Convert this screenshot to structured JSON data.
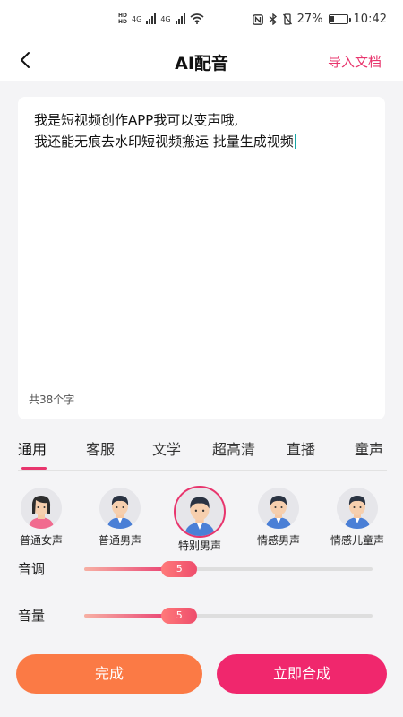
{
  "status_bar": {
    "network_1": "4G",
    "network_2": "4G",
    "battery_percent": "27%",
    "battery_level": 0.27,
    "time": "10:42",
    "icons": [
      "nfc-icon",
      "bluetooth-icon",
      "mute-icon",
      "battery-icon",
      "wifi-icon",
      "signal-icon"
    ]
  },
  "header": {
    "title": "AI配音",
    "import_label": "导入文档"
  },
  "editor": {
    "line1": "我是短视频创作APP我可以变声哦,",
    "line2": "我还能无痕去水印短视频搬运 批量生成视频",
    "char_count": "共38个字"
  },
  "tabs": [
    {
      "label": "通用",
      "active": true
    },
    {
      "label": "客服"
    },
    {
      "label": "文学"
    },
    {
      "label": "超高清"
    },
    {
      "label": "直播"
    },
    {
      "label": "童声"
    }
  ],
  "voices": [
    {
      "label": "普通女声"
    },
    {
      "label": "普通男声"
    },
    {
      "label": "特别男声",
      "selected": true
    },
    {
      "label": "情感男声"
    },
    {
      "label": "情感儿童声"
    }
  ],
  "sliders": {
    "pitch": {
      "label": "音调",
      "value": "5",
      "fraction": 0.33
    },
    "volume": {
      "label": "音量",
      "value": "5",
      "fraction": 0.33
    }
  },
  "buttons": {
    "done": "完成",
    "synthesize": "立即合成"
  },
  "colors": {
    "accent": "#e8356d",
    "done_button": "#fb7a45",
    "synth_button": "#f0276d"
  }
}
